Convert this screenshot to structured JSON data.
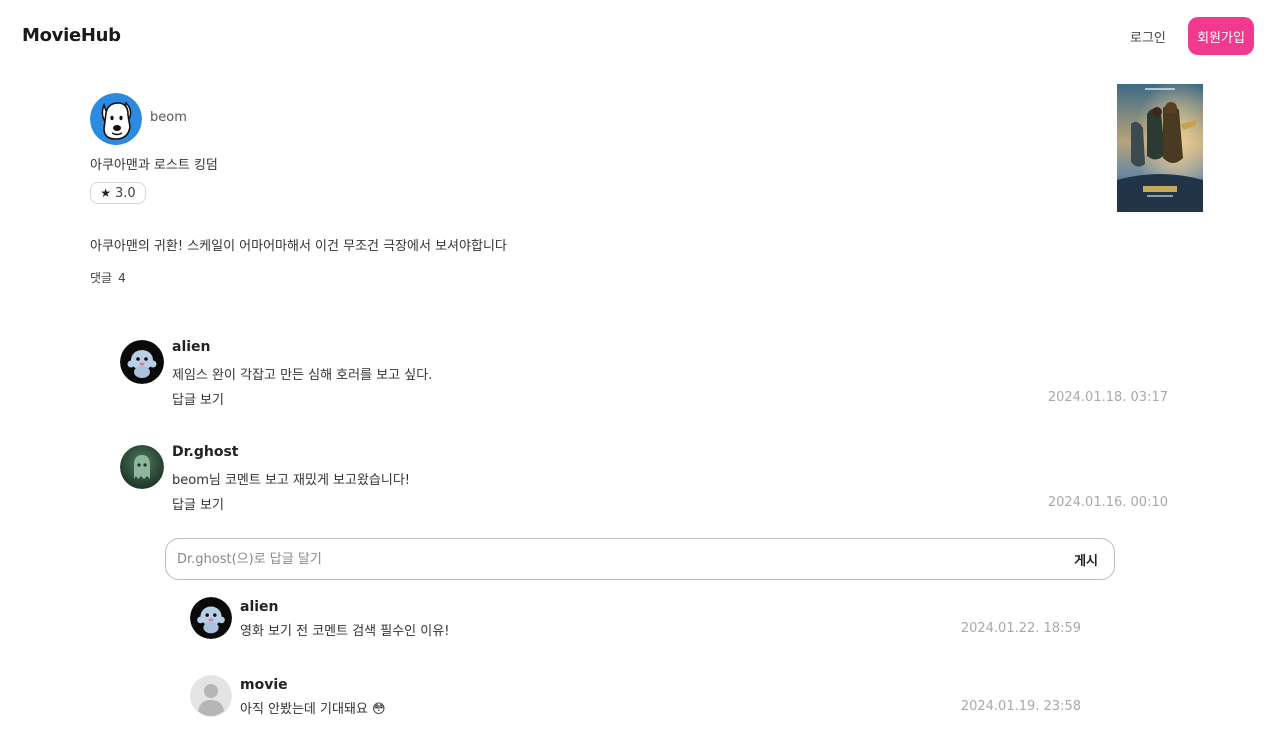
{
  "header": {
    "logo": "MovieHub",
    "login_label": "로그인",
    "signup_label": "회원가입"
  },
  "review": {
    "author": "beom",
    "movie_title": "아쿠아맨과 로스트 킹덤",
    "rating_star": "★",
    "rating": "3.0",
    "body": "아쿠아맨의 귀환! 스케일이 어마어마해서 이건 무조건 극장에서 보셔야합니다",
    "comment_label": "댓글",
    "comment_count": "4"
  },
  "comments": [
    {
      "user": "alien",
      "text": "제임스 완이 각잡고 만든 심해 호러를 보고 싶다.",
      "reply_label": "답글 보기",
      "date": "2024.01.18. 03:17"
    },
    {
      "user": "Dr.ghost",
      "text": "beom님 코멘트 보고 재밌게 보고왔습니다!",
      "reply_label": "답글 보기",
      "date": "2024.01.16. 00:10"
    }
  ],
  "reply_input": {
    "placeholder": "Dr.ghost(으)로 답글 달기",
    "value": "",
    "post_label": "게시"
  },
  "replies": [
    {
      "user": "alien",
      "text": "영화 보기 전 코멘트 검색 필수인 이유!",
      "date": "2024.01.22. 18:59"
    },
    {
      "user": "movie",
      "text": "아직 안봤는데 기대돼요 😳",
      "date": "2024.01.19. 23:58"
    }
  ],
  "colors": {
    "accent": "#f0398f",
    "date_gray": "#a8a8a8"
  },
  "icons": {
    "author_avatar": "dog-avatar-icon",
    "alien_avatar": "plush-toy-avatar",
    "ghost_avatar": "ghost-avatar",
    "default_avatar": "default-user-icon"
  }
}
